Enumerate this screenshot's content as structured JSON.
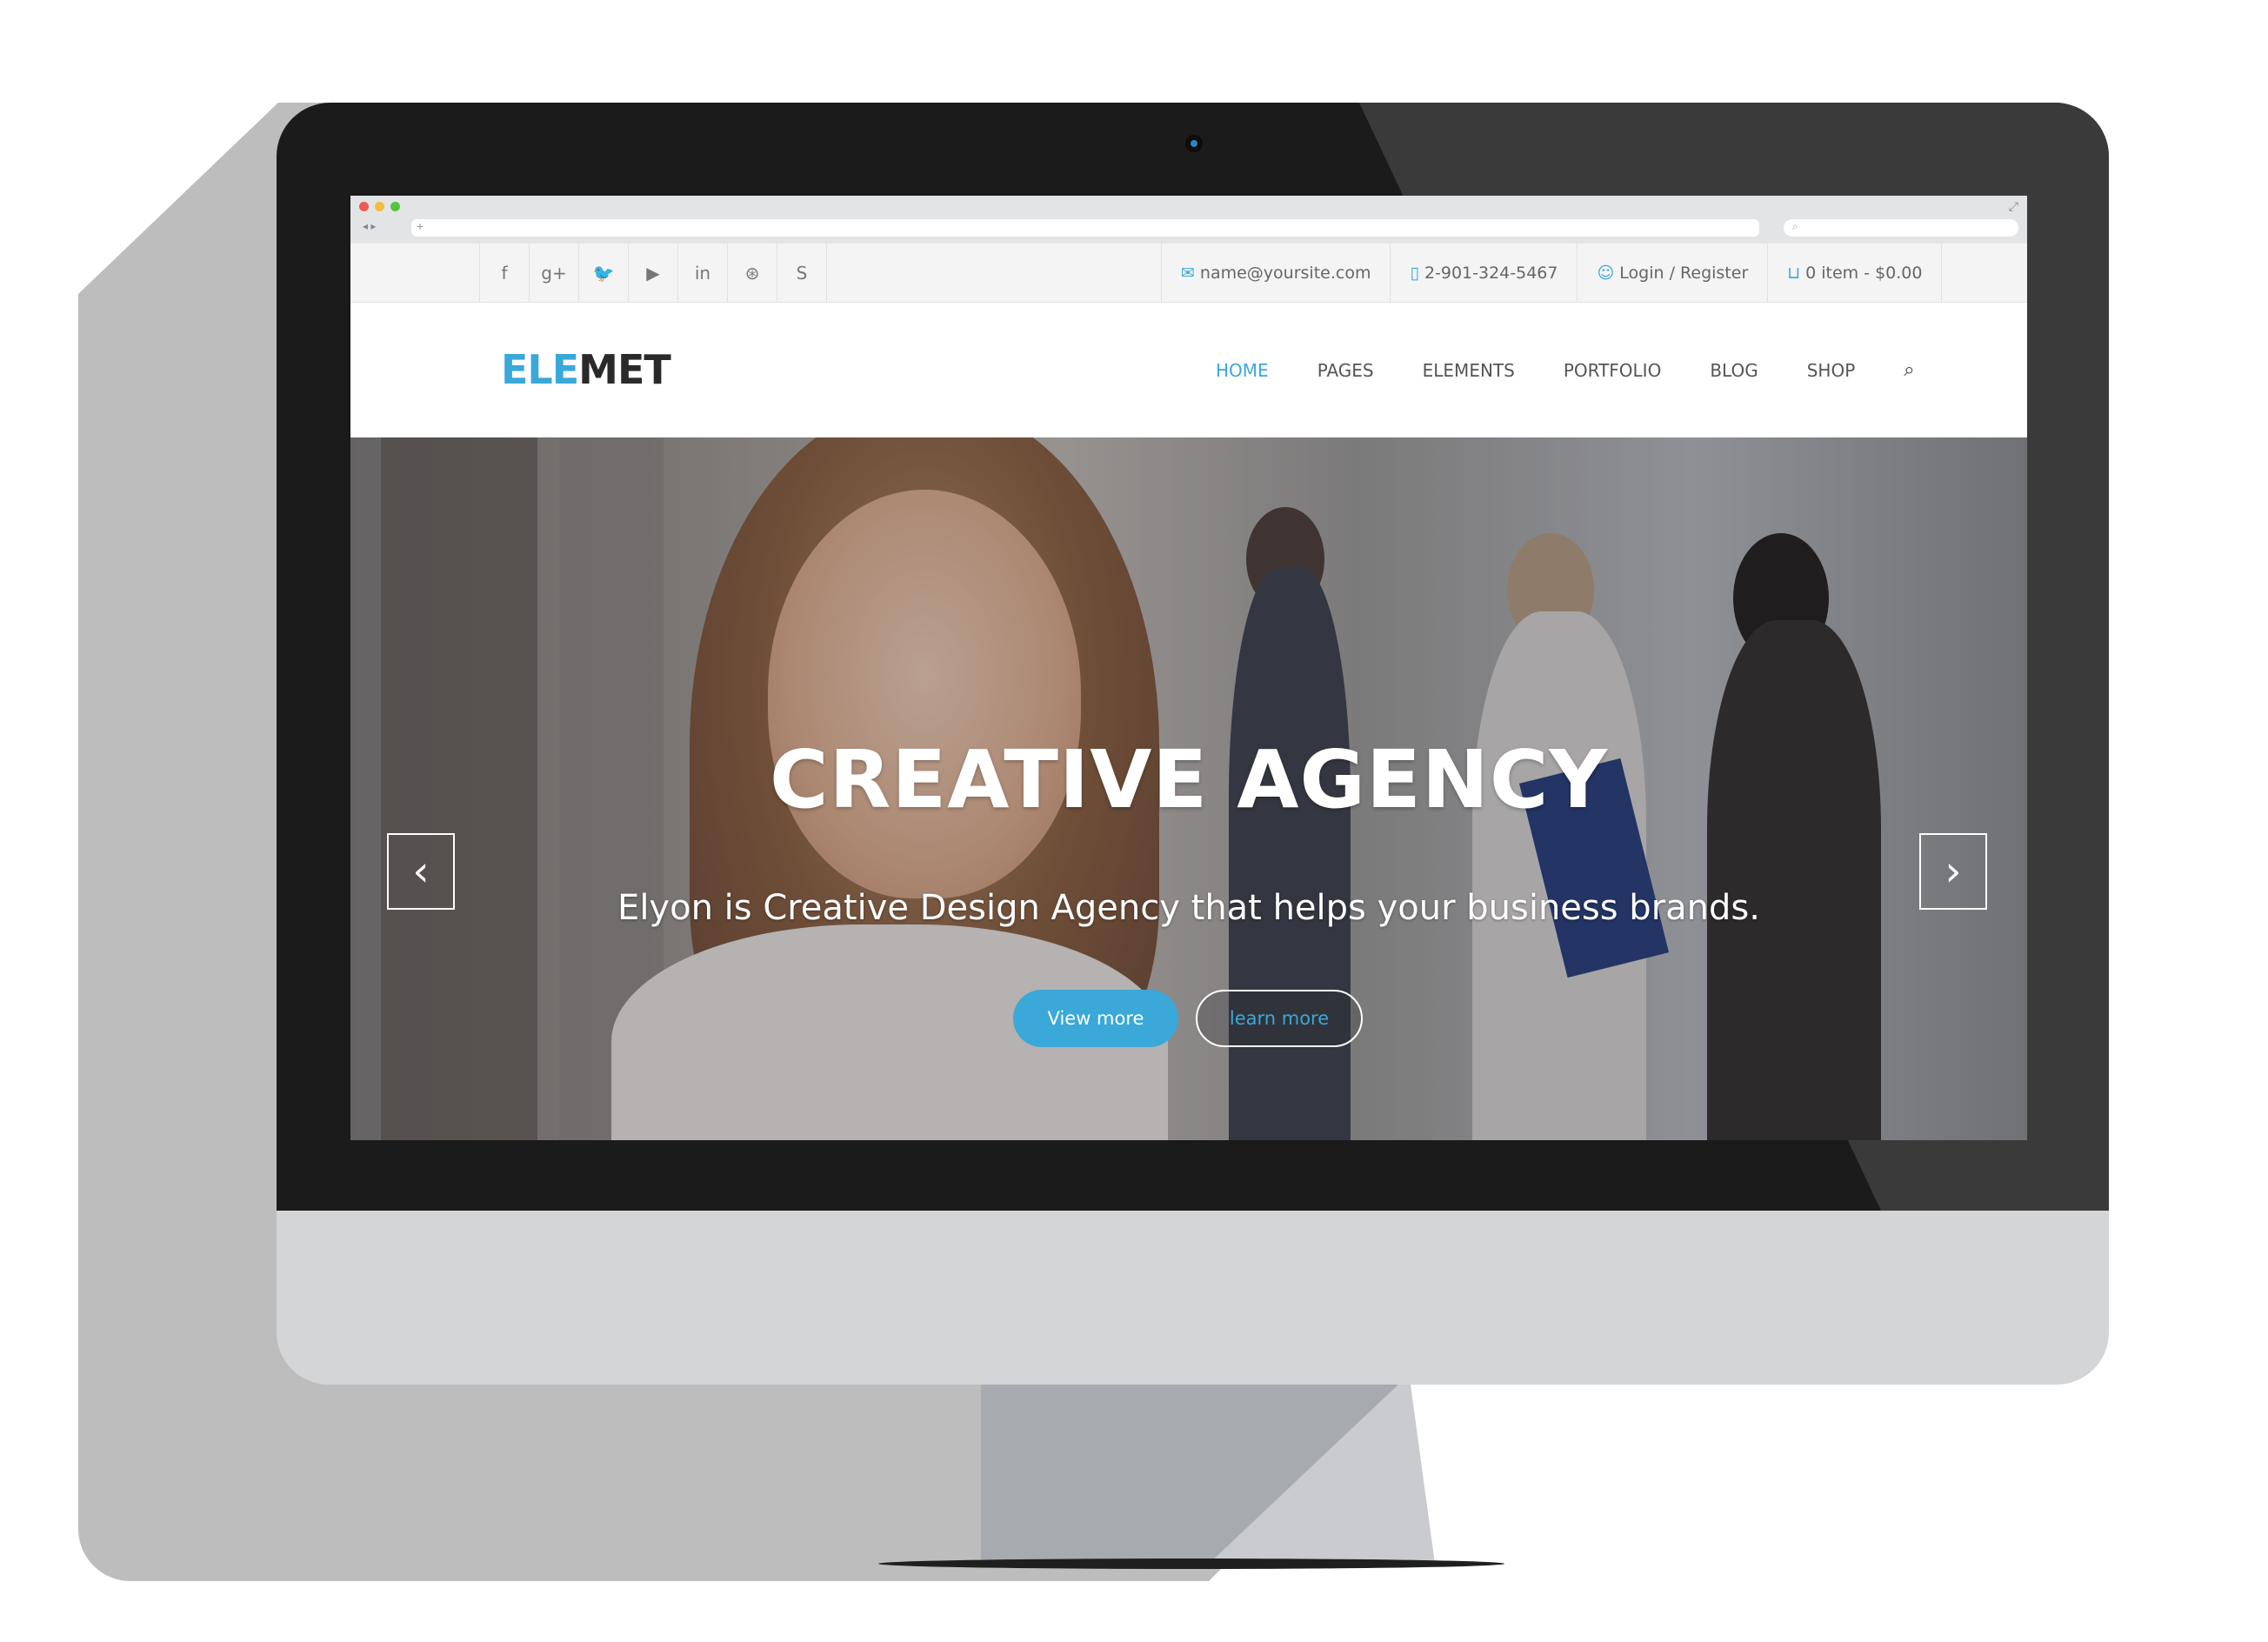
{
  "browser": {
    "nav_arrows": "◂ ▸",
    "new_tab": "+",
    "search_icon": "⌕",
    "expand_icon": "⤢",
    "window_dots": [
      "#ee5b55",
      "#f5bd3e",
      "#56c442"
    ]
  },
  "topbar": {
    "social_icons": [
      "facebook-icon",
      "google-plus-icon",
      "twitter-icon",
      "youtube-icon",
      "linkedin-icon",
      "dribbble-icon",
      "skype-icon"
    ],
    "social_glyphs": [
      "f",
      "g+",
      "🐦",
      "▶",
      "in",
      "⊛",
      "S"
    ],
    "email": "name@yoursite.com",
    "phone": "2-901-324-5467",
    "login": "Login / Register",
    "cart": "0 item - $0.00"
  },
  "header": {
    "logo_part1": "ELE",
    "logo_part2": "MET",
    "menu": {
      "home": "HOME",
      "pages": "PAGES",
      "elements": "ELEMENTS",
      "portfolio": "PORTFOLIO",
      "blog": "BLOG",
      "shop": "SHOP"
    }
  },
  "hero": {
    "title": "CREATIVE AGENCY",
    "subtitle": "Elyon is Creative Design Agency that helps your business brands.",
    "primary_button": "View more",
    "secondary_button": "learn more",
    "prev_arrow": "‹",
    "next_arrow": "›"
  },
  "colors": {
    "accent": "#3aa8d8",
    "bezel": "#1b1b1b",
    "chin": "#d3d5d7"
  }
}
